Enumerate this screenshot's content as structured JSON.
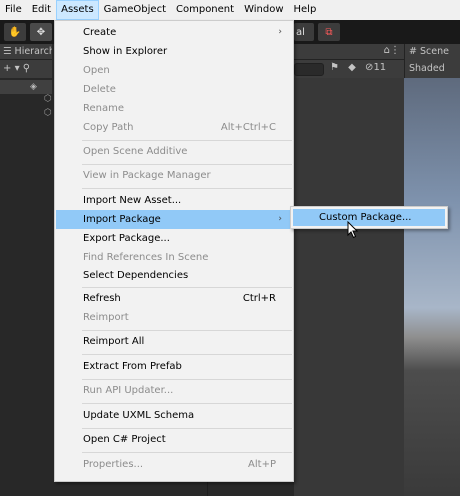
{
  "menubar": {
    "items": [
      {
        "label": "File"
      },
      {
        "label": "Edit"
      },
      {
        "label": "Assets"
      },
      {
        "label": "GameObject"
      },
      {
        "label": "Component"
      },
      {
        "label": "Window"
      },
      {
        "label": "Help"
      }
    ],
    "active": "Assets"
  },
  "toolbar": {
    "right_fragment": "al"
  },
  "hierarchy": {
    "title": "Hierarch",
    "add_label": "+"
  },
  "project": {
    "count": "11"
  },
  "scene": {
    "tab_label": "# Scene",
    "shading_mode": "Shaded"
  },
  "assets_menu": {
    "items": [
      {
        "label": "Create",
        "enabled": true,
        "submenu": true
      },
      {
        "label": "Show in Explorer",
        "enabled": true
      },
      {
        "label": "Open",
        "enabled": false
      },
      {
        "label": "Delete",
        "enabled": false
      },
      {
        "label": "Rename",
        "enabled": false
      },
      {
        "label": "Copy Path",
        "enabled": false,
        "shortcut": "Alt+Ctrl+C"
      },
      {
        "label": "Open Scene Additive",
        "enabled": false
      },
      {
        "label": "View in Package Manager",
        "enabled": false
      },
      {
        "label": "Import New Asset...",
        "enabled": true
      },
      {
        "label": "Import Package",
        "enabled": true,
        "submenu": true,
        "highlighted": true
      },
      {
        "label": "Export Package...",
        "enabled": true
      },
      {
        "label": "Find References In Scene",
        "enabled": false
      },
      {
        "label": "Select Dependencies",
        "enabled": true
      },
      {
        "label": "Refresh",
        "enabled": true,
        "shortcut": "Ctrl+R"
      },
      {
        "label": "Reimport",
        "enabled": false
      },
      {
        "label": "Reimport All",
        "enabled": true
      },
      {
        "label": "Extract From Prefab",
        "enabled": true
      },
      {
        "label": "Run API Updater...",
        "enabled": false
      },
      {
        "label": "Update UXML Schema",
        "enabled": true
      },
      {
        "label": "Open C# Project",
        "enabled": true
      },
      {
        "label": "Properties...",
        "enabled": false,
        "shortcut": "Alt+P"
      }
    ]
  },
  "import_package_submenu": {
    "items": [
      {
        "label": "Custom Package...",
        "highlighted": true
      }
    ]
  },
  "colors": {
    "menu_highlight": "#91c9f7",
    "menubar_active": "#cce8ff",
    "editor_bg": "#282828",
    "menu_bg": "#f2f2f2"
  }
}
